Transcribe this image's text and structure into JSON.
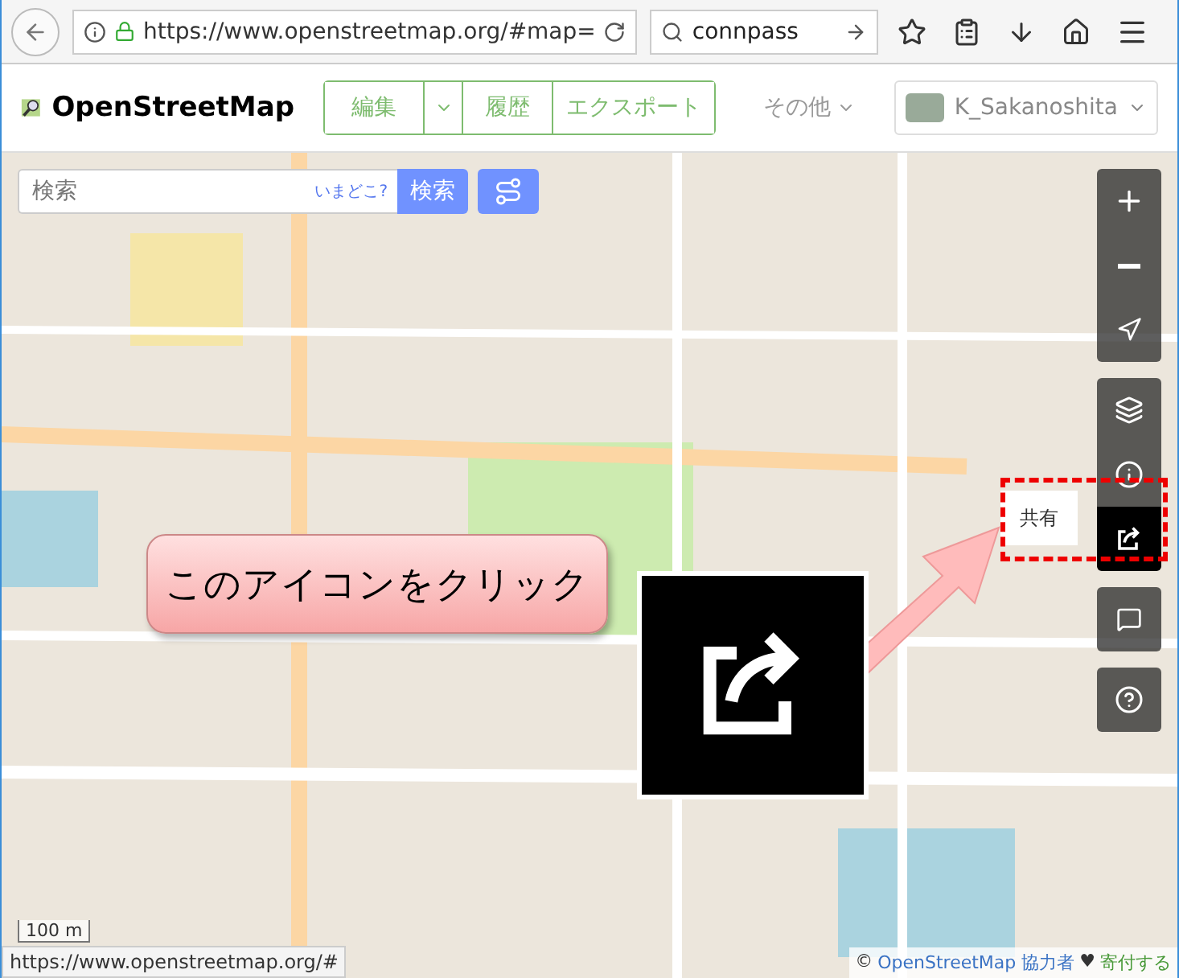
{
  "browser": {
    "url": "https://www.openstreetmap.org/#map=",
    "search": "connpass"
  },
  "header": {
    "logo": "OpenStreetMap",
    "nav": [
      {
        "label": "編集",
        "kind": "dropdown"
      },
      {
        "label": "履歴",
        "kind": "link"
      },
      {
        "label": "エクスポート",
        "kind": "link"
      }
    ],
    "more": "その他",
    "user": "K_Sakanoshita"
  },
  "search": {
    "placeholder": "検索",
    "where": "いまどこ?",
    "button": "検索"
  },
  "map_controls": [
    [
      {
        "kind": "zoom-in",
        "selected": false
      },
      {
        "kind": "zoom-out",
        "selected": false
      },
      {
        "kind": "locate",
        "selected": false
      }
    ],
    [
      {
        "kind": "layers",
        "selected": false
      },
      {
        "kind": "info",
        "selected": false
      },
      {
        "kind": "share",
        "selected": true
      }
    ],
    [
      {
        "kind": "note",
        "selected": false
      }
    ],
    [
      {
        "kind": "help",
        "selected": false
      }
    ]
  ],
  "share_label": "共有",
  "scale": "100 m",
  "status_url": "https://www.openstreetmap.org/#",
  "attribution": {
    "copyright": "©",
    "link": "OpenStreetMap 協力者",
    "heart": "♥",
    "donate": "寄付する"
  },
  "callout": "このアイコンをクリック"
}
